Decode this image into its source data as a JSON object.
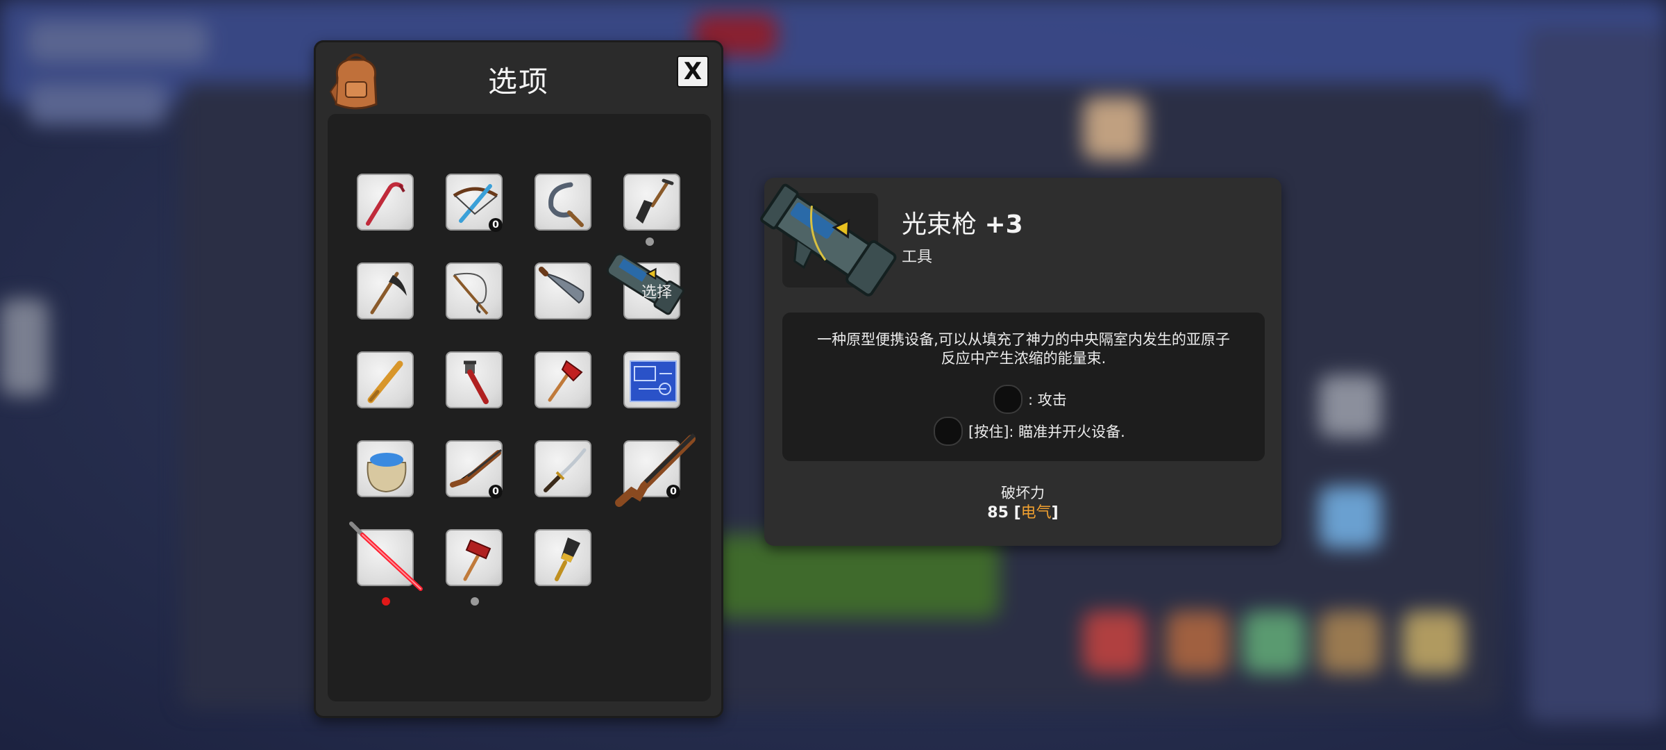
{
  "inventory": {
    "title": "选项",
    "close_label": "X",
    "select_label": "选择",
    "items": [
      {
        "name": "crowbar",
        "badge": ""
      },
      {
        "name": "crossbow",
        "badge": "0"
      },
      {
        "name": "sickle",
        "badge": ""
      },
      {
        "name": "shovel",
        "badge": ""
      },
      {
        "name": "scythe",
        "badge": ""
      },
      {
        "name": "fishing-rod",
        "badge": ""
      },
      {
        "name": "machete",
        "badge": ""
      },
      {
        "name": "beam-gun",
        "badge": ""
      },
      {
        "name": "baseball-bat",
        "badge": ""
      },
      {
        "name": "pipe-wrench",
        "badge": ""
      },
      {
        "name": "fire-axe",
        "badge": ""
      },
      {
        "name": "blueprint",
        "badge": ""
      },
      {
        "name": "seed-bag",
        "badge": ""
      },
      {
        "name": "rifle",
        "badge": "0"
      },
      {
        "name": "katana",
        "badge": ""
      },
      {
        "name": "shotgun",
        "badge": "0"
      },
      {
        "name": "laser-sword",
        "badge": ""
      },
      {
        "name": "sledgehammer",
        "badge": ""
      },
      {
        "name": "paintbrush",
        "badge": ""
      }
    ]
  },
  "detail": {
    "name": "光束枪",
    "level": "+3",
    "type": "工具",
    "description_line1": "一种原型便携设备,可以从填充了神力的中央隔室内发生的亚原子",
    "description_line2": "反应中产生浓缩的能量束.",
    "control1": ": 攻击",
    "control2": "[按住]: 瞄准并开火设备.",
    "stat_label": "破坏力",
    "stat_value": "85",
    "stat_element_open": "[",
    "stat_element": "电气",
    "stat_element_close": "]"
  },
  "colors": {
    "panel": "#2b2b2b",
    "element_text": "#f0a030",
    "red_dot": "#e01818",
    "grey_dot": "#9a9a9a"
  }
}
